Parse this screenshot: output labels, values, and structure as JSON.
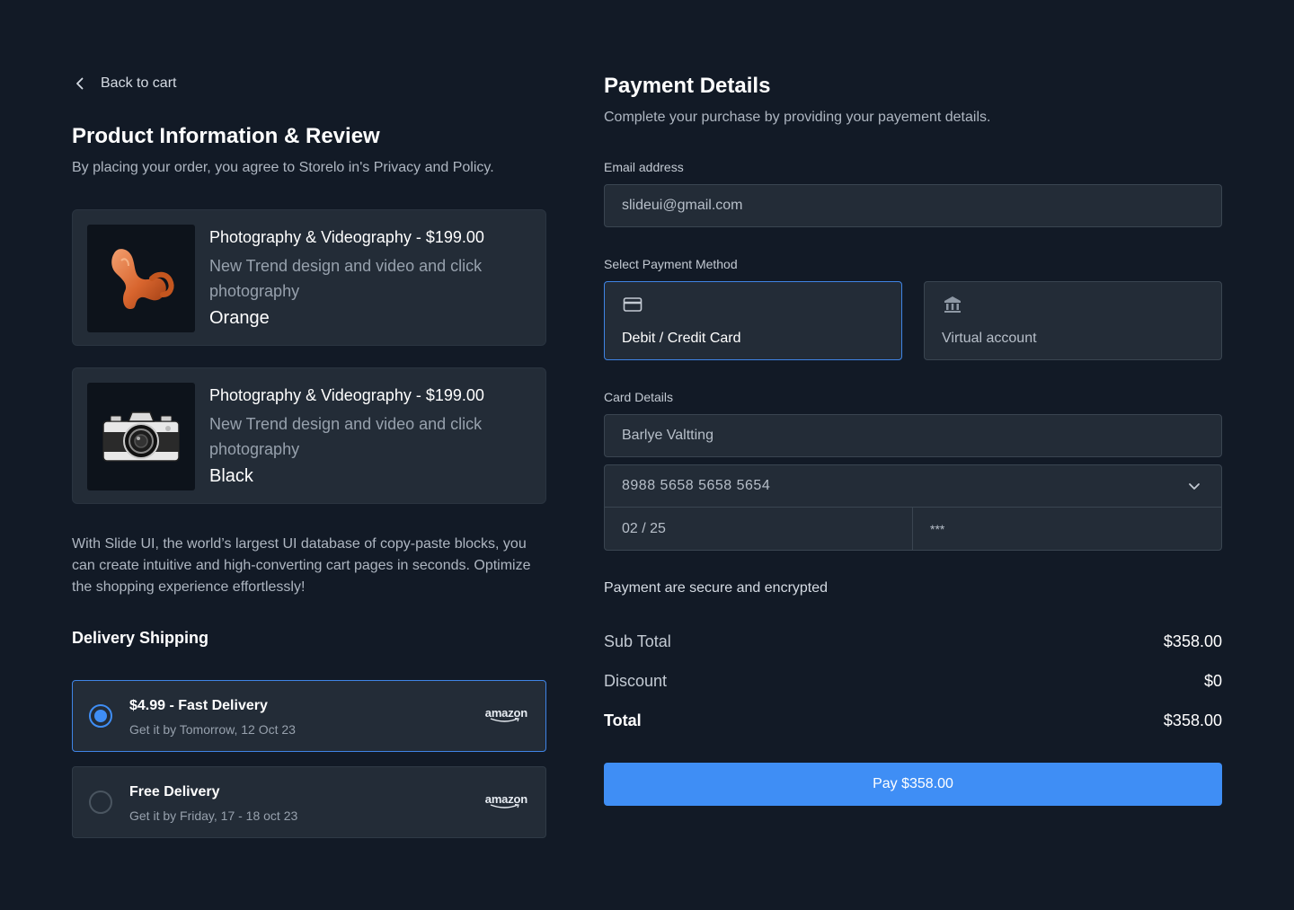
{
  "left": {
    "back_label": "Back to cart",
    "title": "Product Information & Review",
    "subtitle": "By placing your order, you agree to Storelo in's Privacy and Policy.",
    "products": [
      {
        "title": "Photography & Videography - $199.00",
        "description": "New Trend design and video and click photography",
        "variant": "Orange",
        "image_icon": "orange-chair-icon"
      },
      {
        "title": "Photography & Videography - $199.00",
        "description": "New Trend design and video and click photography",
        "variant": "Black",
        "image_icon": "camera-icon"
      }
    ],
    "blurb": "With Slide UI, the world’s largest UI database of copy-paste blocks, you can create intuitive and high-converting cart pages in seconds. Optimize the shopping experience effortlessly!",
    "delivery_title": "Delivery Shipping",
    "shipping_options": [
      {
        "name": "$4.99 - Fast Delivery",
        "eta": "Get it by Tomorrow, 12 Oct 23",
        "brand": "amazon",
        "selected": true
      },
      {
        "name": "Free Delivery",
        "eta": "Get it by Friday, 17 - 18 oct 23",
        "brand": "amazon",
        "selected": false
      }
    ]
  },
  "right": {
    "title": "Payment Details",
    "subtitle": "Complete your purchase by providing your payement details.",
    "email_label": "Email address",
    "email_value": "slideui@gmail.com",
    "method_label": "Select Payment Method",
    "methods": [
      {
        "label": "Debit / Credit Card",
        "icon": "credit-card-icon",
        "selected": true
      },
      {
        "label": "Virtual account",
        "icon": "bank-icon",
        "selected": false
      }
    ],
    "card_label": "Card Details",
    "card_name": "Barlye Valtting",
    "card_number": "8988 5658 5658 5654",
    "card_expiry": "02 / 25",
    "card_cvc": "***",
    "secure_note": "Payment are secure and encrypted",
    "summary": {
      "subtotal_label": "Sub Total",
      "subtotal_value": "$358.00",
      "discount_label": "Discount",
      "discount_value": "$0",
      "total_label": "Total",
      "total_value": "$358.00"
    },
    "pay_button": "Pay $358.00"
  },
  "colors": {
    "background": "#121a26",
    "card": "#232c37",
    "accent": "#3f8ef5"
  }
}
